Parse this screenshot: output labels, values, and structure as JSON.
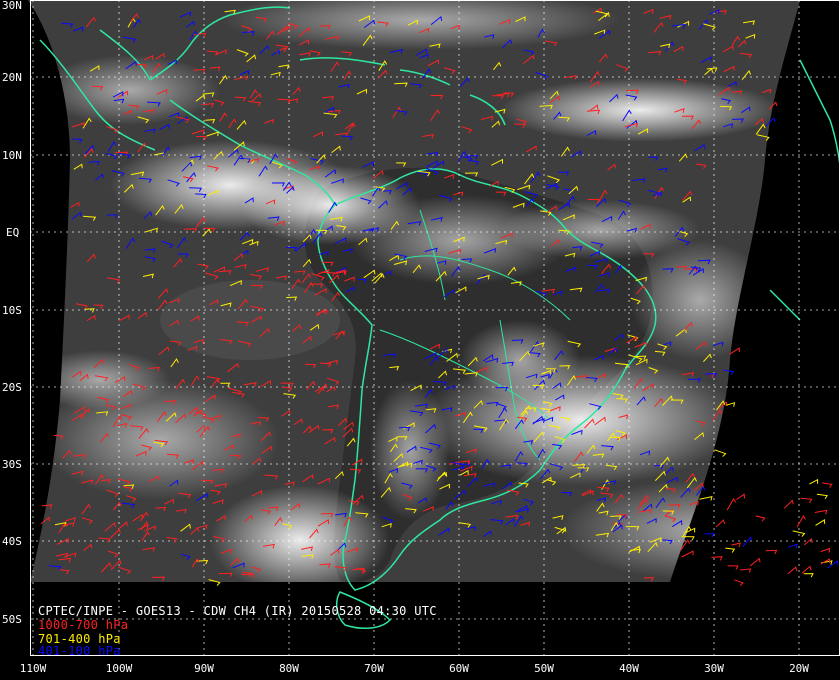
{
  "map": {
    "title": "CPTEC/INPE - GOES13 - CDW CH4 (IR) 20150528 04:30 UTC",
    "lat_labels": [
      "30N",
      "20N",
      "10N",
      "EQ",
      "10S",
      "20S",
      "30S",
      "40S",
      "50S"
    ],
    "lon_labels": [
      "110W",
      "100W",
      "90W",
      "80W",
      "70W",
      "60W",
      "50W",
      "40W",
      "30W",
      "20W"
    ],
    "legend": [
      {
        "label": "1000-700 hPa",
        "color": "#ff2020"
      },
      {
        "label": "701-400 hPa",
        "color": "#ffee00"
      },
      {
        "label": "401-100 hPa",
        "color": "#0a0aff"
      }
    ],
    "colors": {
      "coastline": "#2ee8a0",
      "gridlines": "#ffffff",
      "space": "#000000",
      "cloud_bright": "#f2f2f2",
      "cloud_background": "#4a4a4a"
    },
    "icons": [
      "wind-barb-icon"
    ]
  }
}
